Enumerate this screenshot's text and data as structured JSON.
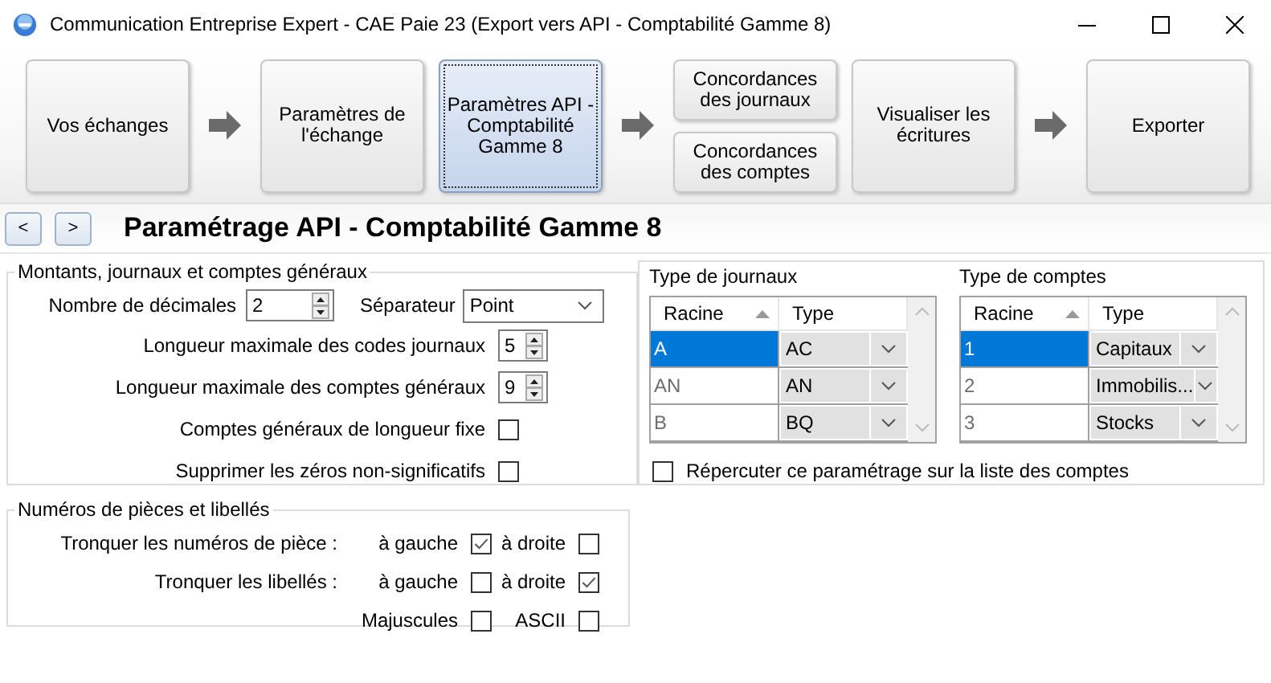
{
  "window": {
    "title": "Communication Entreprise Expert - CAE Paie 23 (Export vers API - Comptabilité Gamme 8)"
  },
  "steps": [
    {
      "arrow_after": true,
      "buttons": [
        {
          "label": "Vos échanges",
          "selected": false
        }
      ]
    },
    {
      "arrow_after": false,
      "buttons": [
        {
          "label": "Paramètres de l'échange",
          "selected": false
        }
      ]
    },
    {
      "arrow_after": true,
      "buttons": [
        {
          "label": "Paramètres API - Comptabilité Gamme 8",
          "selected": true
        }
      ]
    },
    {
      "arrow_after": false,
      "buttons": [
        {
          "label": "Concordances des journaux",
          "selected": false
        },
        {
          "label": "Concordances des comptes",
          "selected": false
        }
      ]
    },
    {
      "arrow_after": true,
      "buttons": [
        {
          "label": "Visualiser les écritures",
          "selected": false
        }
      ]
    },
    {
      "arrow_after": false,
      "buttons": [
        {
          "label": "Exporter",
          "selected": false
        }
      ]
    }
  ],
  "header": {
    "nav": [
      "<",
      ">"
    ],
    "title": "Paramétrage API - Comptabilité Gamme 8"
  },
  "montants": {
    "title": "Montants, journaux et comptes généraux",
    "decimales": {
      "label": "Nombre de décimales",
      "value": "2"
    },
    "separateur": {
      "label": "Séparateur",
      "value": "Point"
    },
    "fields": [
      {
        "label": "Longueur maximale des codes journaux",
        "value": "5"
      },
      {
        "label": "Longueur maximale des comptes généraux",
        "value": "9"
      }
    ],
    "checks": [
      {
        "label": "Comptes généraux de longueur fixe",
        "checked": false
      },
      {
        "label": "Supprimer les zéros non-significatifs",
        "checked": false
      }
    ]
  },
  "types": {
    "journaux": {
      "title": "Type de journaux",
      "columns": [
        "Racine",
        "Type"
      ],
      "rows": [
        {
          "racine": "A",
          "type": "AC",
          "selected": true
        },
        {
          "racine": "AN",
          "type": "AN",
          "selected": false
        },
        {
          "racine": "B",
          "type": "BQ",
          "selected": false
        }
      ]
    },
    "comptes": {
      "title": "Type de comptes",
      "columns": [
        "Racine",
        "Type"
      ],
      "rows": [
        {
          "racine": "1",
          "type": "Capitaux",
          "selected": true
        },
        {
          "racine": "2",
          "type": "Immobilis...",
          "selected": false
        },
        {
          "racine": "3",
          "type": "Stocks",
          "selected": false
        }
      ]
    },
    "repercuter": {
      "label": "Répercuter ce paramétrage sur la liste des comptes",
      "checked": false
    }
  },
  "pieces": {
    "title": "Numéros de pièces et libellés",
    "rows": [
      {
        "label": "Tronquer les numéros de pièce :",
        "options": [
          {
            "label": "à gauche",
            "checked": true
          },
          {
            "label": "à droite",
            "checked": false
          }
        ]
      },
      {
        "label": "Tronquer les libellés :",
        "options": [
          {
            "label": "à gauche",
            "checked": false
          },
          {
            "label": "à droite",
            "checked": true
          }
        ]
      },
      {
        "options": [
          {
            "label": "Majuscules",
            "checked": false
          },
          {
            "label": "ASCII",
            "checked": false
          }
        ]
      }
    ]
  }
}
